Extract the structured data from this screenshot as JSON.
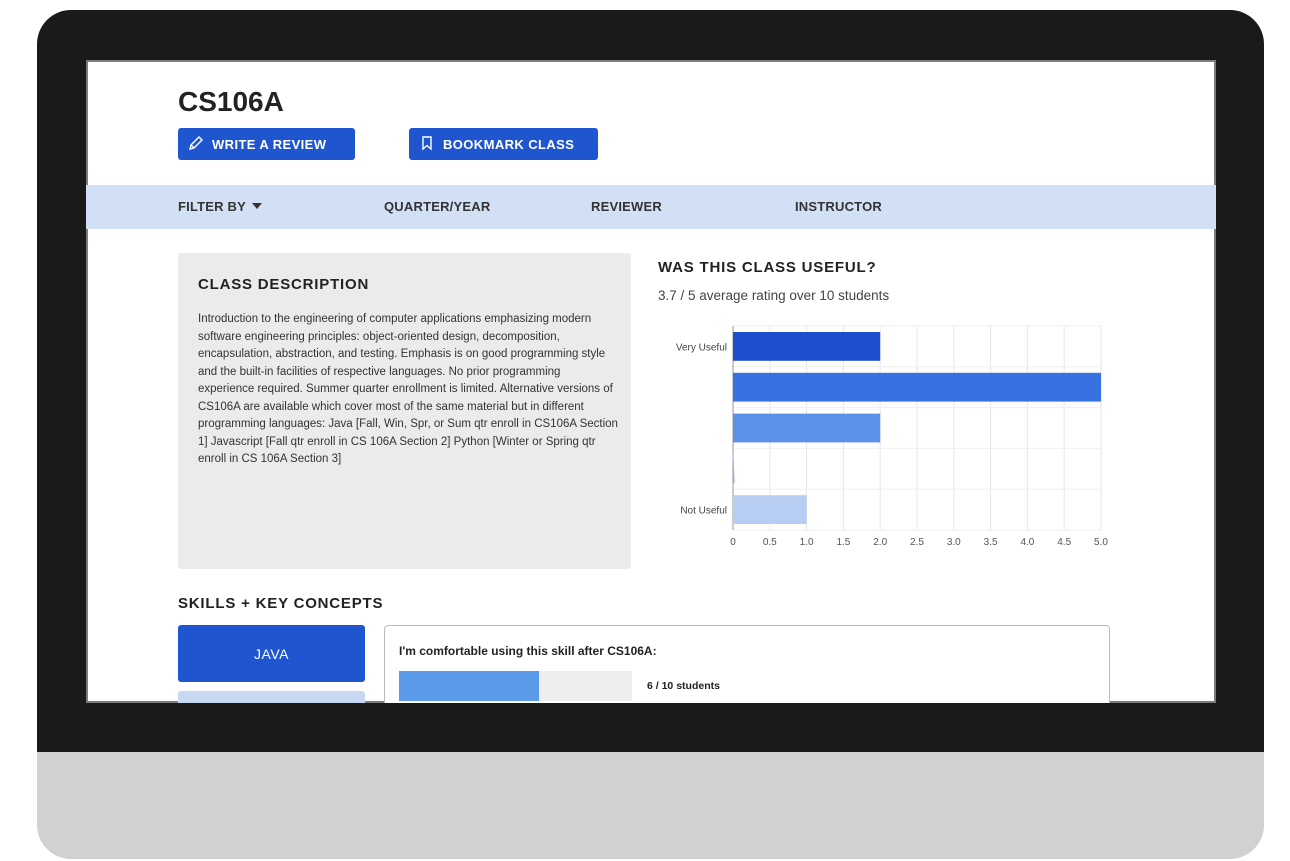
{
  "course": {
    "title": "CS106A",
    "write_review_label": "WRITE A REVIEW",
    "bookmark_label": "BOOKMARK CLASS"
  },
  "filter_bar": {
    "filter_by_label": "FILTER BY",
    "items": [
      "QUARTER/YEAR",
      "REVIEWER",
      "INSTRUCTOR"
    ]
  },
  "description": {
    "title": "CLASS DESCRIPTION",
    "text": "Introduction to the engineering of computer applications emphasizing modern software engineering principles: object-oriented design, decomposition, encapsulation, abstraction, and testing. Emphasis is on good programming style and the built-in facilities of respective languages. No prior programming experience required. Summer quarter enrollment is limited. Alternative versions of CS106A are available which cover most of the same material but in different programming languages: Java [Fall, Win, Spr, or Sum qtr enroll in CS106A Section 1] Javascript [Fall qtr enroll in CS 106A Section 2] Python [Winter or Spring qtr enroll in CS 106A Section 3]"
  },
  "usefulness": {
    "title": "WAS THIS CLASS USEFUL?",
    "summary": "3.7 / 5 average rating over 10 students"
  },
  "chart_data": {
    "type": "bar",
    "orientation": "horizontal",
    "categories": [
      "Very Useful",
      "",
      "",
      "",
      "Not Useful"
    ],
    "values": [
      2,
      5,
      2,
      0,
      1
    ],
    "colors": [
      "#1e4fd0",
      "#3673e0",
      "#5b91e8",
      "#8ab0ee",
      "#b7cdf3"
    ],
    "xlim": [
      0,
      5
    ],
    "xticks": [
      "0",
      "0.5",
      "1.0",
      "1.5",
      "2.0",
      "2.5",
      "3.0",
      "3.5",
      "4.0",
      "4.5",
      "5.0"
    ],
    "grid": true
  },
  "skills": {
    "title": "SKILLS + KEY CONCEPTS",
    "active_skill": "JAVA",
    "question": "I'm comfortable using this skill after CS106A:",
    "comfort_fraction": 0.6,
    "count_label": "6 / 10 students"
  }
}
